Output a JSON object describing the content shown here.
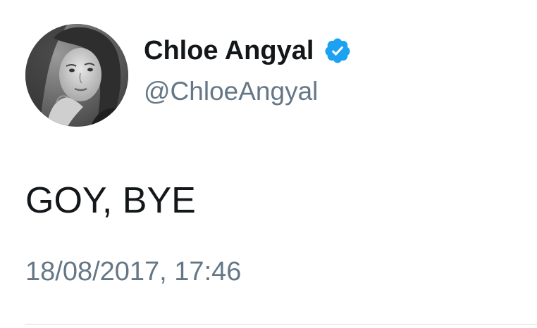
{
  "tweet": {
    "author": {
      "display_name": "Chloe Angyal",
      "handle": "@ChloeAngyal",
      "verified_icon": "verified-badge-icon",
      "avatar_icon": "profile-photo"
    },
    "text": "GOY, BYE",
    "timestamp": "18/08/2017, 17:46"
  },
  "colors": {
    "name_text": "#14171a",
    "secondary_text": "#657786",
    "verified_blue": "#1da1f2",
    "divider": "#d6dbdf"
  }
}
